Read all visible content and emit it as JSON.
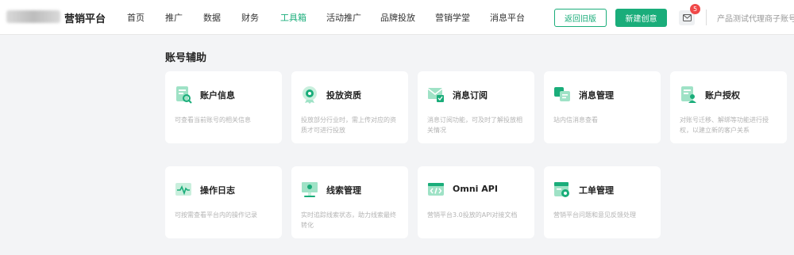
{
  "header": {
    "brand": "营销平台",
    "nav": [
      "首页",
      "推广",
      "数据",
      "财务",
      "工具箱",
      "活动推广",
      "品牌投放",
      "营销学堂",
      "消息平台"
    ],
    "active_nav": "工具箱",
    "back_old_label": "返回旧版",
    "new_creative_label": "新建创意",
    "mail_badge": "5",
    "user_text": "产品测试代理商子账号"
  },
  "section": {
    "title": "账号辅助"
  },
  "cards": [
    {
      "icon": "account-info-icon",
      "title": "账户信息",
      "desc": "可查看当前账号的相关信息"
    },
    {
      "icon": "qualification-icon",
      "title": "投放资质",
      "desc": "投放部分行业时，需上传对应的资质才可进行投放"
    },
    {
      "icon": "message-subscribe-icon",
      "title": "消息订阅",
      "desc": "消息订阅功能，可及时了解投放相关情况"
    },
    {
      "icon": "message-manage-icon",
      "title": "消息管理",
      "desc": "站内信消息查看"
    },
    {
      "icon": "account-auth-icon",
      "title": "账户授权",
      "desc": "对账号迁移、解绑等功能进行授权，以建立新的客户关系"
    },
    {
      "icon": "operation-log-icon",
      "title": "操作日志",
      "desc": "可按需查看平台内的操作记录"
    },
    {
      "icon": "lead-manage-icon",
      "title": "线索管理",
      "desc": "实时追踪线索状态，助力线索最终转化"
    },
    {
      "icon": "api-icon",
      "title": "Omni API",
      "desc": "营销平台3.0投放的API对接文档"
    },
    {
      "icon": "ticket-manage-icon",
      "title": "工单管理",
      "desc": "营销平台问题和意见反馈处理"
    }
  ],
  "colors": {
    "accent": "#1aad7a",
    "badge": "#f04848"
  }
}
